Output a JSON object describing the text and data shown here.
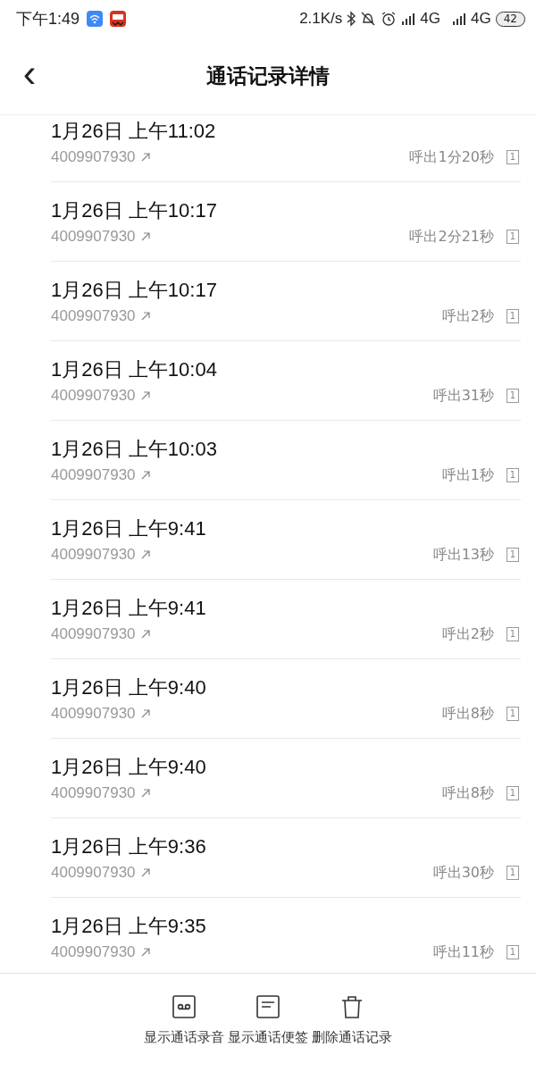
{
  "status_bar": {
    "time": "下午1:49",
    "speed": "2.1K/s",
    "network_1": "4G",
    "network_2": "4G",
    "battery": "42"
  },
  "header": {
    "back": "‹",
    "title": "通话记录详情"
  },
  "calls": [
    {
      "date": "1月26日 上午11:02",
      "number": "4009907930",
      "result": "呼出1分20秒",
      "sim": "1"
    },
    {
      "date": "1月26日 上午10:17",
      "number": "4009907930",
      "result": "呼出2分21秒",
      "sim": "1"
    },
    {
      "date": "1月26日 上午10:17",
      "number": "4009907930",
      "result": "呼出2秒",
      "sim": "1"
    },
    {
      "date": "1月26日 上午10:04",
      "number": "4009907930",
      "result": "呼出31秒",
      "sim": "1"
    },
    {
      "date": "1月26日 上午10:03",
      "number": "4009907930",
      "result": "呼出1秒",
      "sim": "1"
    },
    {
      "date": "1月26日 上午9:41",
      "number": "4009907930",
      "result": "呼出13秒",
      "sim": "1"
    },
    {
      "date": "1月26日 上午9:41",
      "number": "4009907930",
      "result": "呼出2秒",
      "sim": "1"
    },
    {
      "date": "1月26日 上午9:40",
      "number": "4009907930",
      "result": "呼出8秒",
      "sim": "1"
    },
    {
      "date": "1月26日 上午9:40",
      "number": "4009907930",
      "result": "呼出8秒",
      "sim": "1"
    },
    {
      "date": "1月26日 上午9:36",
      "number": "4009907930",
      "result": "呼出30秒",
      "sim": "1"
    },
    {
      "date": "1月26日 上午9:35",
      "number": "4009907930",
      "result": "呼出11秒",
      "sim": "1"
    }
  ],
  "actions": [
    {
      "kind": "recording",
      "label": "显示通话录音"
    },
    {
      "kind": "note",
      "label": "显示通话便签"
    },
    {
      "kind": "delete",
      "label": "删除通话记录"
    }
  ]
}
